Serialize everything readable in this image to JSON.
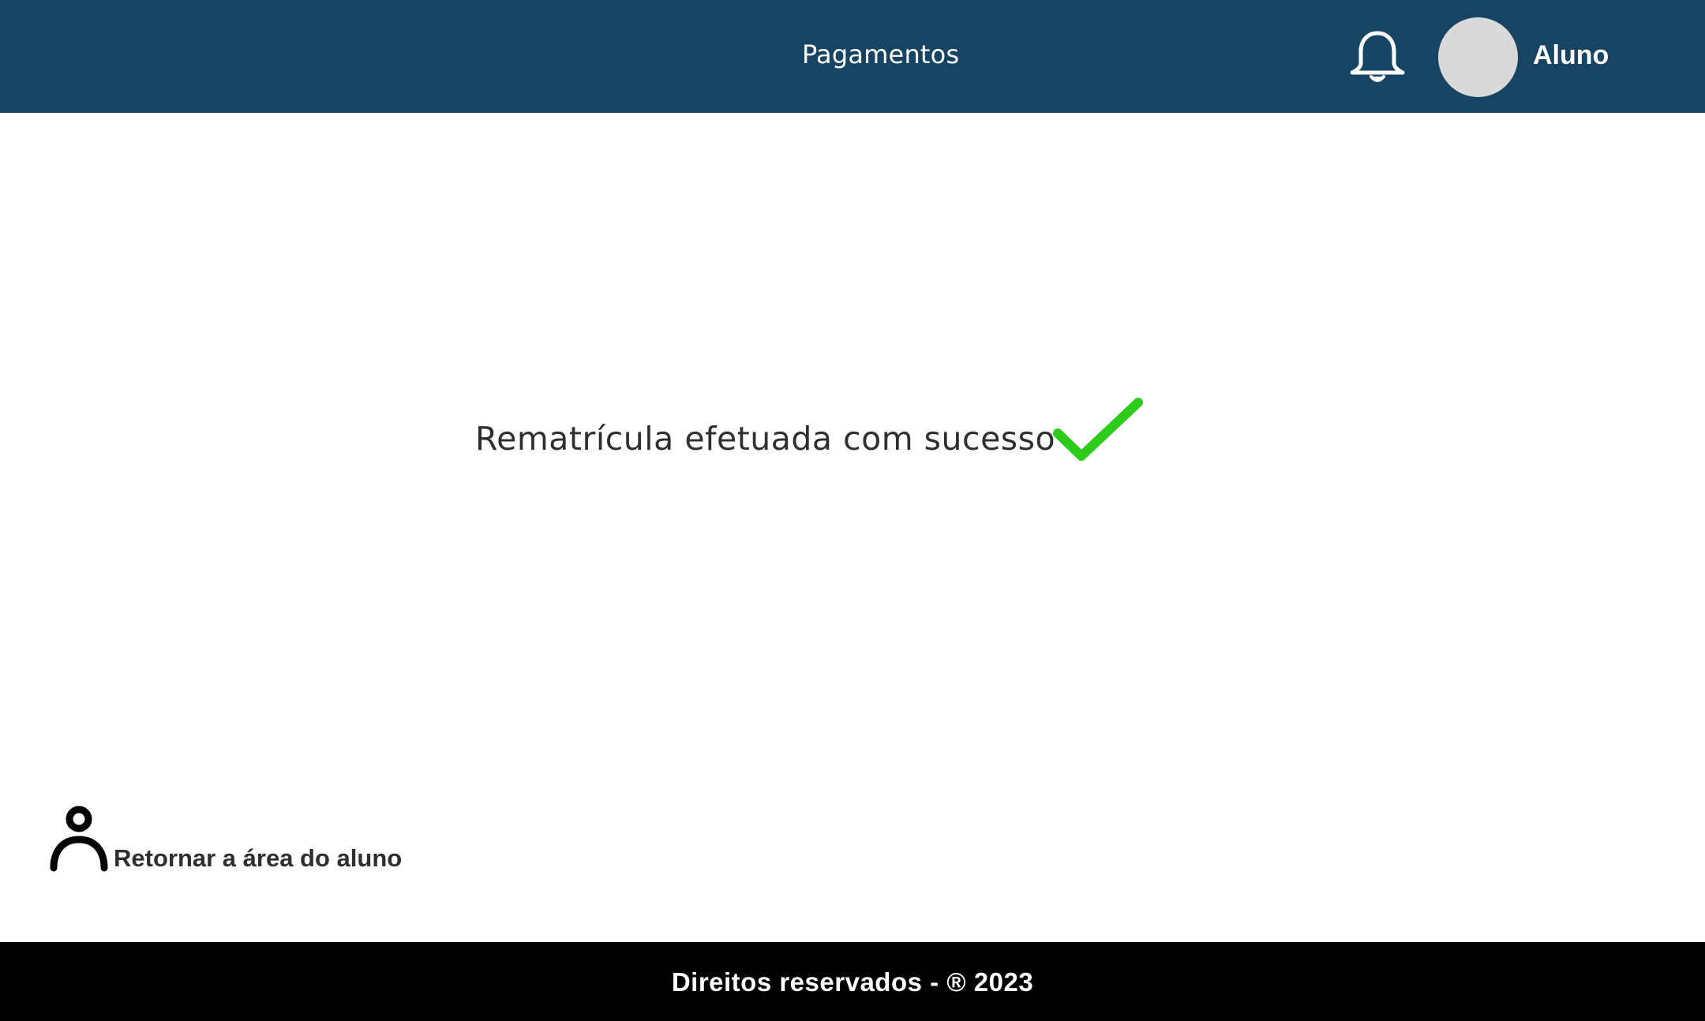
{
  "header": {
    "nav_label": "Pagamentos",
    "bell_icon": "bell-icon",
    "user_name": "Aluno",
    "background_color": "#164462"
  },
  "main": {
    "message": "Rematrícula efetuada com sucesso",
    "check_icon": "checkmark-icon",
    "check_color": "#2ecc1a"
  },
  "return_link": {
    "label": "Retornar a área do aluno",
    "icon": "person-icon"
  },
  "footer": {
    "text": "Direitos reservados - ® 2023",
    "background_color": "#000000"
  }
}
